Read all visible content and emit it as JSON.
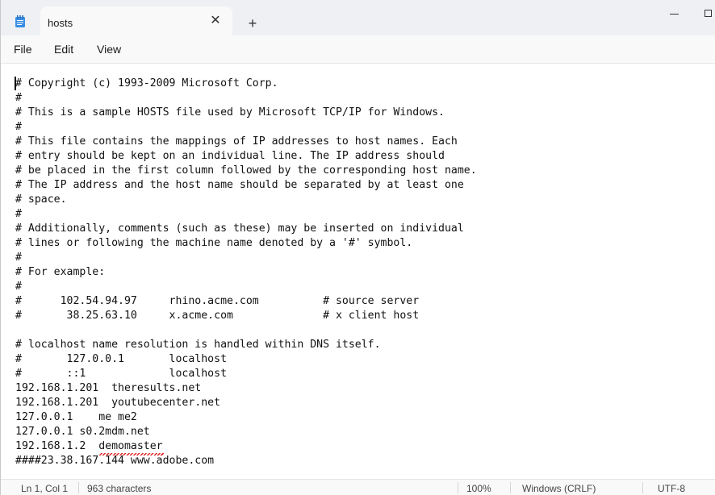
{
  "tab": {
    "title": "hosts",
    "close_glyph": "✕",
    "new_tab_glyph": "+",
    "app_icon": "notepad-icon"
  },
  "menu": {
    "file": "File",
    "edit": "Edit",
    "view": "View"
  },
  "editor": {
    "lines": [
      "# Copyright (c) 1993-2009 Microsoft Corp.",
      "#",
      "# This is a sample HOSTS file used by Microsoft TCP/IP for Windows.",
      "#",
      "# This file contains the mappings of IP addresses to host names. Each",
      "# entry should be kept on an individual line. The IP address should",
      "# be placed in the first column followed by the corresponding host name.",
      "# The IP address and the host name should be separated by at least one",
      "# space.",
      "#",
      "# Additionally, comments (such as these) may be inserted on individual",
      "# lines or following the machine name denoted by a '#' symbol.",
      "#",
      "# For example:",
      "#",
      "#      102.54.94.97     rhino.acme.com          # source server",
      "#       38.25.63.10     x.acme.com              # x client host",
      "",
      "# localhost name resolution is handled within DNS itself.",
      "#       127.0.0.1       localhost",
      "#       ::1             localhost",
      "192.168.1.201  theresults.net",
      "192.168.1.201  youtubecenter.net",
      "127.0.0.1    me me2",
      "127.0.0.1 s0.2mdm.net",
      "192.168.1.2  demomaster",
      "####23.38.167.144 www.adobe.com"
    ]
  },
  "status": {
    "position": "Ln 1, Col 1",
    "characters": "963 characters",
    "zoom": "100%",
    "line_ending": "Windows (CRLF)",
    "encoding": "UTF-8"
  },
  "colors": {
    "titlebar_bg": "#eef0f4",
    "tab_bg": "#f9f9f9",
    "icon_blue": "#3a8ee6",
    "spell_error": "#dd2222"
  }
}
